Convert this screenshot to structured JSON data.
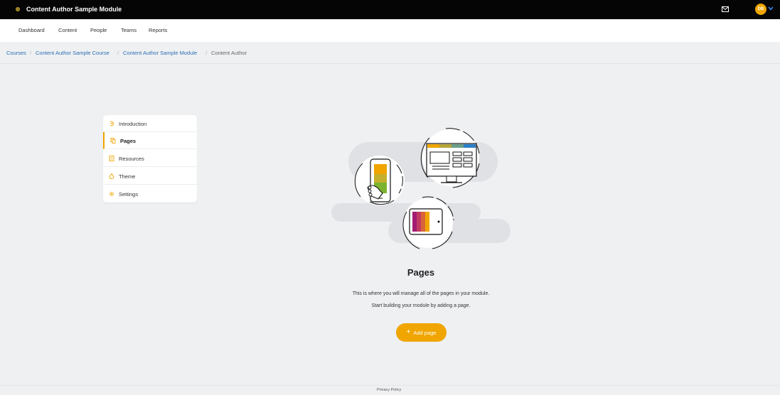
{
  "header": {
    "title": "Content Author Sample Module",
    "avatar_initials": "DB",
    "accent_color": "#f0a500"
  },
  "nav": {
    "items": [
      {
        "label": "Dashboard"
      },
      {
        "label": "Content"
      },
      {
        "label": "People"
      },
      {
        "label": "Teams"
      },
      {
        "label": "Reports"
      }
    ]
  },
  "breadcrumb": {
    "items": [
      {
        "label": "Courses"
      },
      {
        "label": "Content Author Sample Course"
      },
      {
        "label": "Content Author Sample Module"
      }
    ],
    "separator": "/",
    "current": "Content Author"
  },
  "sidebar": {
    "items": [
      {
        "label": "Introduction",
        "icon": "introduction-icon"
      },
      {
        "label": "Pages",
        "icon": "pages-icon",
        "active": true
      },
      {
        "label": "Resources",
        "icon": "resources-icon"
      },
      {
        "label": "Theme",
        "icon": "theme-icon"
      },
      {
        "label": "Settings",
        "icon": "settings-icon"
      }
    ]
  },
  "empty_state": {
    "title": "Pages",
    "line1": "This is where you will manage all of the pages in your module.",
    "line2": "Start building your module by adding a page.",
    "button_plus": "+",
    "button_label": "Add page"
  },
  "footer": {
    "link": "Privacy Policy"
  }
}
